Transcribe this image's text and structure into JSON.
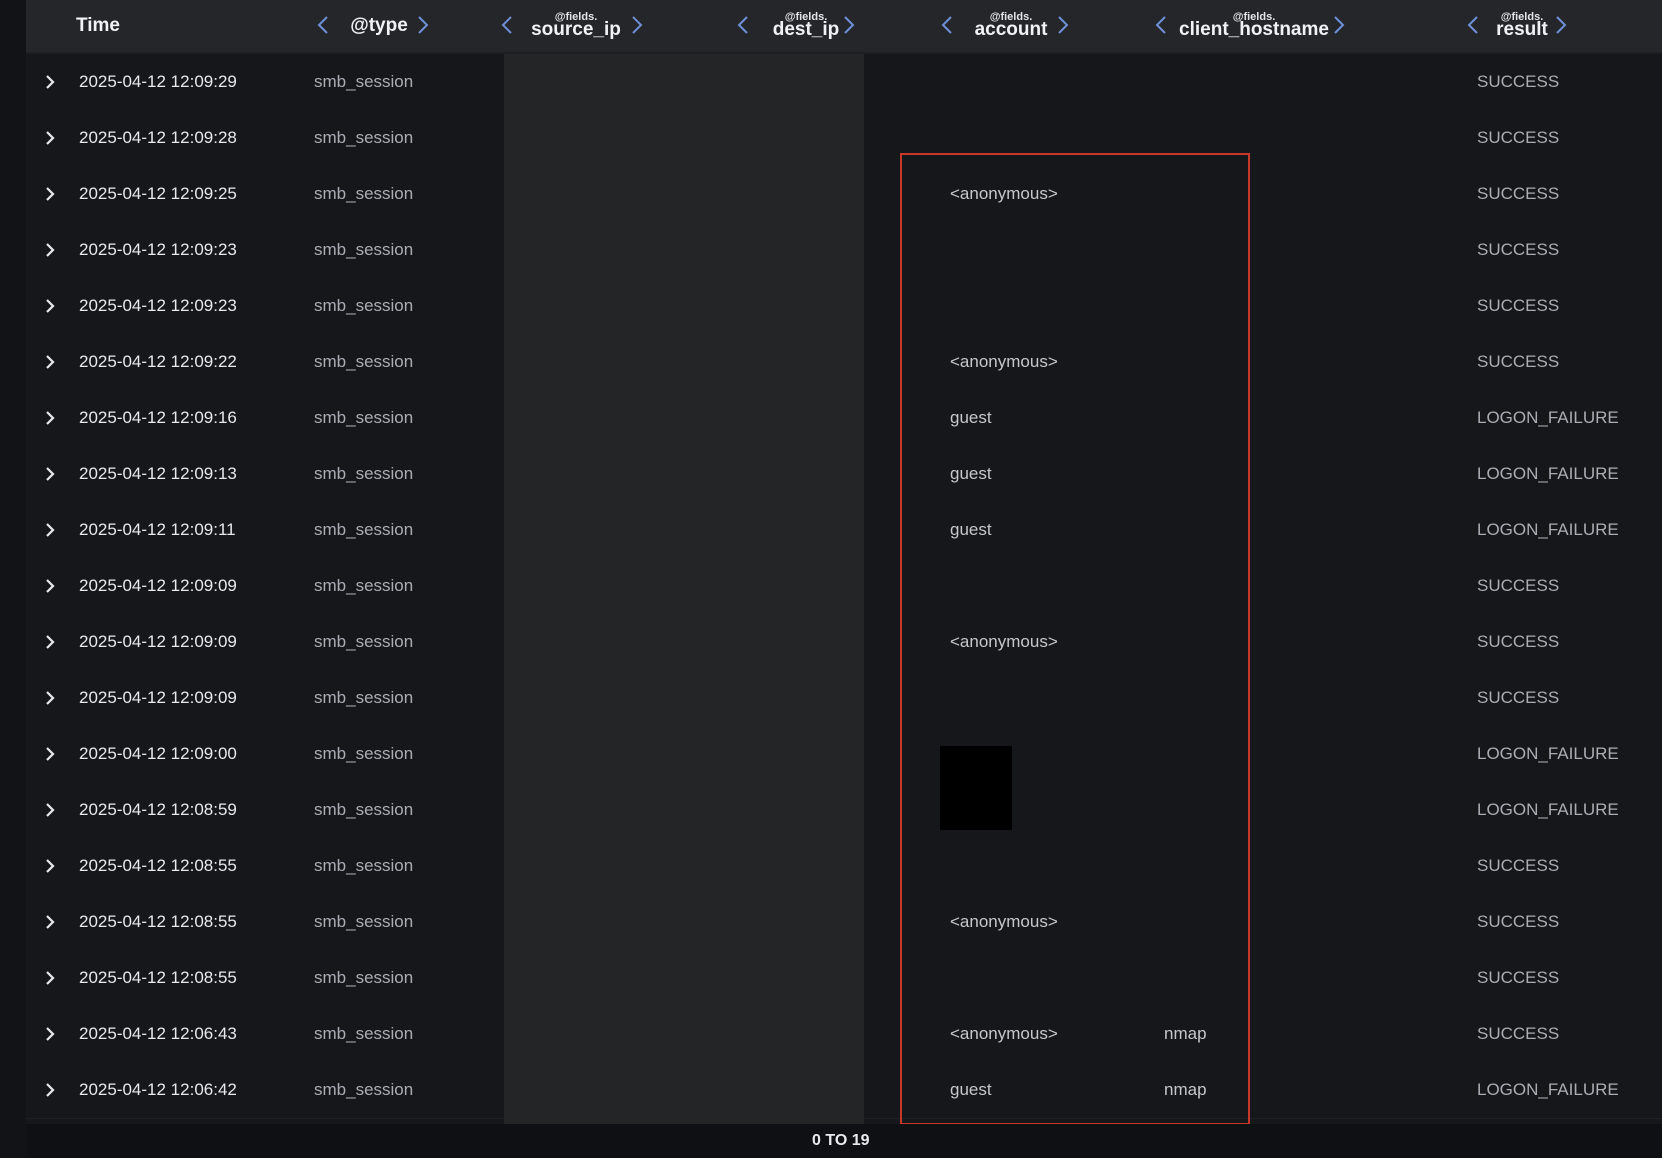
{
  "columns": {
    "time": {
      "label": "Time"
    },
    "type": {
      "label": "@type"
    },
    "source_ip": {
      "prefix": "@fields.",
      "label": "source_ip"
    },
    "dest_ip": {
      "prefix": "@fields.",
      "label": "dest_ip"
    },
    "account": {
      "prefix": "@fields.",
      "label": "account"
    },
    "client_hostname": {
      "prefix": "@fields.",
      "label": "client_hostname"
    },
    "result": {
      "prefix": "@fields.",
      "label": "result"
    }
  },
  "rows": [
    {
      "time": "2025-04-12 12:09:29",
      "type": "smb_session",
      "account": "",
      "client": "",
      "result": "SUCCESS"
    },
    {
      "time": "2025-04-12 12:09:28",
      "type": "smb_session",
      "account": "",
      "client": "",
      "result": "SUCCESS"
    },
    {
      "time": "2025-04-12 12:09:25",
      "type": "smb_session",
      "account": "<anonymous>",
      "client": "",
      "result": "SUCCESS"
    },
    {
      "time": "2025-04-12 12:09:23",
      "type": "smb_session",
      "account": "",
      "client": "",
      "result": "SUCCESS"
    },
    {
      "time": "2025-04-12 12:09:23",
      "type": "smb_session",
      "account": "",
      "client": "",
      "result": "SUCCESS"
    },
    {
      "time": "2025-04-12 12:09:22",
      "type": "smb_session",
      "account": "<anonymous>",
      "client": "",
      "result": "SUCCESS"
    },
    {
      "time": "2025-04-12 12:09:16",
      "type": "smb_session",
      "account": "guest",
      "client": "",
      "result": "LOGON_FAILURE"
    },
    {
      "time": "2025-04-12 12:09:13",
      "type": "smb_session",
      "account": "guest",
      "client": "",
      "result": "LOGON_FAILURE"
    },
    {
      "time": "2025-04-12 12:09:11",
      "type": "smb_session",
      "account": "guest",
      "client": "",
      "result": "LOGON_FAILURE"
    },
    {
      "time": "2025-04-12 12:09:09",
      "type": "smb_session",
      "account": "",
      "client": "",
      "result": "SUCCESS"
    },
    {
      "time": "2025-04-12 12:09:09",
      "type": "smb_session",
      "account": "<anonymous>",
      "client": "",
      "result": "SUCCESS"
    },
    {
      "time": "2025-04-12 12:09:09",
      "type": "smb_session",
      "account": "",
      "client": "",
      "result": "SUCCESS"
    },
    {
      "time": "2025-04-12 12:09:00",
      "type": "smb_session",
      "account": "",
      "client": "",
      "result": "LOGON_FAILURE"
    },
    {
      "time": "2025-04-12 12:08:59",
      "type": "smb_session",
      "account": "",
      "client": "",
      "result": "LOGON_FAILURE"
    },
    {
      "time": "2025-04-12 12:08:55",
      "type": "smb_session",
      "account": "",
      "client": "",
      "result": "SUCCESS"
    },
    {
      "time": "2025-04-12 12:08:55",
      "type": "smb_session",
      "account": "<anonymous>",
      "client": "",
      "result": "SUCCESS"
    },
    {
      "time": "2025-04-12 12:08:55",
      "type": "smb_session",
      "account": "",
      "client": "",
      "result": "SUCCESS"
    },
    {
      "time": "2025-04-12 12:06:43",
      "type": "smb_session",
      "account": "<anonymous>",
      "client": "nmap",
      "result": "SUCCESS"
    },
    {
      "time": "2025-04-12 12:06:42",
      "type": "smb_session",
      "account": "guest",
      "client": "nmap",
      "result": "LOGON_FAILURE"
    }
  ],
  "footer": {
    "pager": "0 TO 19"
  },
  "colors": {
    "accent": "#6f8fd8",
    "highlight": "#c8382a"
  },
  "icons": {
    "expand": "chevron-right-icon",
    "move_left": "chevron-left-icon",
    "move_right": "chevron-right-icon"
  }
}
